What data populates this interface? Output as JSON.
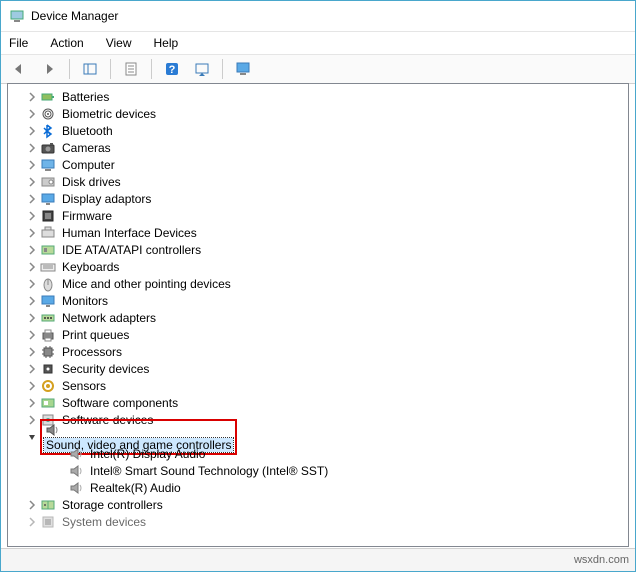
{
  "window": {
    "title": "Device Manager"
  },
  "menu": {
    "items": [
      "File",
      "Action",
      "View",
      "Help"
    ]
  },
  "toolbar": {
    "back": "back-arrow",
    "forward": "forward-arrow",
    "show_hidden": "show-hidden",
    "properties": "properties",
    "help": "help",
    "action": "action",
    "monitor": "monitor"
  },
  "tree": {
    "categories": [
      {
        "icon": "battery",
        "label": "Batteries",
        "expanded": false
      },
      {
        "icon": "fingerprint",
        "label": "Biometric devices",
        "expanded": false
      },
      {
        "icon": "bluetooth",
        "label": "Bluetooth",
        "expanded": false
      },
      {
        "icon": "camera",
        "label": "Cameras",
        "expanded": false
      },
      {
        "icon": "computer",
        "label": "Computer",
        "expanded": false
      },
      {
        "icon": "disk",
        "label": "Disk drives",
        "expanded": false
      },
      {
        "icon": "display",
        "label": "Display adaptors",
        "expanded": false
      },
      {
        "icon": "firmware",
        "label": "Firmware",
        "expanded": false
      },
      {
        "icon": "hid",
        "label": "Human Interface Devices",
        "expanded": false
      },
      {
        "icon": "ide",
        "label": "IDE ATA/ATAPI controllers",
        "expanded": false
      },
      {
        "icon": "keyboard",
        "label": "Keyboards",
        "expanded": false
      },
      {
        "icon": "mouse",
        "label": "Mice and other pointing devices",
        "expanded": false
      },
      {
        "icon": "monitor",
        "label": "Monitors",
        "expanded": false
      },
      {
        "icon": "network",
        "label": "Network adapters",
        "expanded": false
      },
      {
        "icon": "printer",
        "label": "Print queues",
        "expanded": false
      },
      {
        "icon": "cpu",
        "label": "Processors",
        "expanded": false
      },
      {
        "icon": "security",
        "label": "Security devices",
        "expanded": false
      },
      {
        "icon": "sensor",
        "label": "Sensors",
        "expanded": false
      },
      {
        "icon": "swcomp",
        "label": "Software components",
        "expanded": false
      },
      {
        "icon": "swdev",
        "label": "Software devices",
        "expanded": false
      },
      {
        "icon": "sound",
        "label": "Sound, video and game controllers",
        "expanded": true,
        "selected": true,
        "highlight": true,
        "children": [
          {
            "icon": "speaker",
            "label": "Intel(R) Display Audio"
          },
          {
            "icon": "speaker",
            "label": "Intel® Smart Sound Technology (Intel® SST)"
          },
          {
            "icon": "speaker",
            "label": "Realtek(R) Audio"
          }
        ]
      },
      {
        "icon": "storage",
        "label": "Storage controllers",
        "expanded": false
      },
      {
        "icon": "system",
        "label": "System devices",
        "expanded": false,
        "cut": true
      }
    ]
  },
  "status": {
    "text": "wsxdn.com"
  }
}
